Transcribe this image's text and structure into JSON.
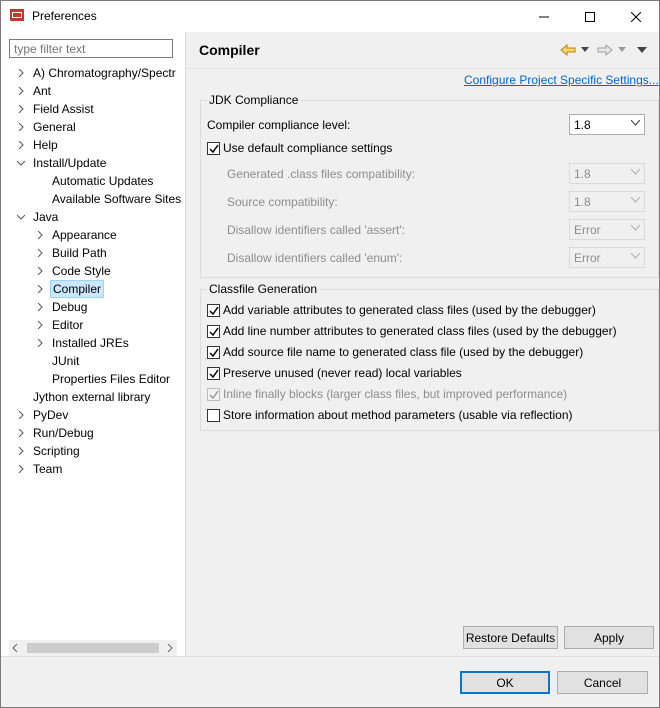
{
  "window": {
    "title": "Preferences"
  },
  "filter": {
    "placeholder": "type filter text"
  },
  "tree": [
    {
      "label": "A) Chromatography/Spectr",
      "has_arrow": true
    },
    {
      "label": "Ant",
      "has_arrow": true
    },
    {
      "label": "Field Assist",
      "has_arrow": true
    },
    {
      "label": "General",
      "has_arrow": true
    },
    {
      "label": "Help",
      "has_arrow": true
    },
    {
      "label": "Install/Update",
      "has_arrow": true,
      "expanded": true
    },
    {
      "label": "Automatic Updates",
      "has_arrow": false,
      "child": true
    },
    {
      "label": "Available Software Sites",
      "has_arrow": false,
      "child": true
    },
    {
      "label": "Java",
      "has_arrow": true,
      "expanded": true
    },
    {
      "label": "Appearance",
      "has_arrow": true,
      "child": true
    },
    {
      "label": "Build Path",
      "has_arrow": true,
      "child": true
    },
    {
      "label": "Code Style",
      "has_arrow": true,
      "child": true
    },
    {
      "label": "Compiler",
      "has_arrow": true,
      "child": true,
      "selected": true
    },
    {
      "label": "Debug",
      "has_arrow": true,
      "child": true
    },
    {
      "label": "Editor",
      "has_arrow": true,
      "child": true
    },
    {
      "label": "Installed JREs",
      "has_arrow": true,
      "child": true
    },
    {
      "label": "JUnit",
      "has_arrow": false,
      "child": true
    },
    {
      "label": "Properties Files Editor",
      "has_arrow": false,
      "child": true
    },
    {
      "label": "Jython external library",
      "has_arrow": false
    },
    {
      "label": "PyDev",
      "has_arrow": true
    },
    {
      "label": "Run/Debug",
      "has_arrow": true
    },
    {
      "label": "Scripting",
      "has_arrow": true
    },
    {
      "label": "Team",
      "has_arrow": true
    }
  ],
  "page": {
    "title": "Compiler",
    "configure_link": "Configure Project Specific Settings...",
    "jdk": {
      "group_title": "JDK Compliance",
      "level_label": "Compiler compliance level:",
      "level_value": "1.8",
      "use_default_label": "Use default compliance settings",
      "use_default_checked": true,
      "generated_label": "Generated .class files compatibility:",
      "generated_value": "1.8",
      "source_label": "Source compatibility:",
      "source_value": "1.8",
      "assert_label": "Disallow identifiers called 'assert':",
      "assert_value": "Error",
      "enum_label": "Disallow identifiers called 'enum':",
      "enum_value": "Error"
    },
    "classfile": {
      "group_title": "Classfile Generation",
      "options": [
        {
          "label": "Add variable attributes to generated class files (used by the debugger)",
          "checked": true,
          "enabled": true
        },
        {
          "label": "Add line number attributes to generated class files (used by the debugger)",
          "checked": true,
          "enabled": true
        },
        {
          "label": "Add source file name to generated class file (used by the debugger)",
          "checked": true,
          "enabled": true
        },
        {
          "label": "Preserve unused (never read) local variables",
          "checked": true,
          "enabled": true
        },
        {
          "label": "Inline finally blocks (larger class files, but improved performance)",
          "checked": true,
          "enabled": false
        },
        {
          "label": "Store information about method parameters (usable via reflection)",
          "checked": false,
          "enabled": true
        }
      ]
    },
    "restore_defaults": "Restore Defaults",
    "apply": "Apply"
  },
  "footer": {
    "ok": "OK",
    "cancel": "Cancel"
  },
  "colors": {
    "selection": "#cce8ff",
    "link": "#0066cc",
    "default_button_border": "#0078d7"
  }
}
